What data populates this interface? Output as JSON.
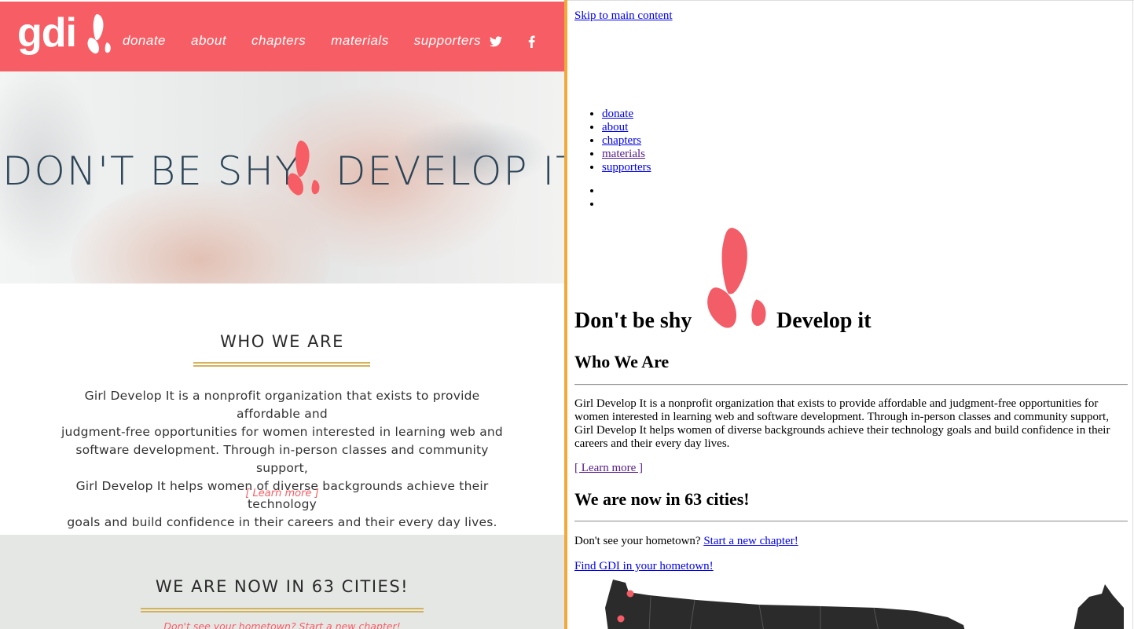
{
  "left": {
    "logo": "gdi",
    "nav": [
      "donate",
      "about",
      "chapters",
      "materials",
      "supporters"
    ],
    "social": {
      "twitter": "twitter-icon",
      "facebook": "facebook-icon"
    },
    "hero": {
      "title_part1": "DON'T BE SHY",
      "title_part2": "DEVELOP IT"
    },
    "who": {
      "title": "WHO WE ARE",
      "lines": [
        "Girl Develop It is a nonprofit organization that exists to provide affordable and",
        "judgment-free opportunities for women interested in learning web and",
        "software development. Through in-person classes and community support,",
        "Girl Develop It helps women of diverse backgrounds achieve their technology",
        "goals and build confidence in their careers and their every day lives."
      ],
      "learn_more": "[ Learn more ]"
    },
    "cities": {
      "title": "WE ARE NOW IN 63 CITIES!",
      "subtitle": "Don't see your hometown? Start a new chapter!"
    }
  },
  "right": {
    "skip": "Skip to main content",
    "nav": [
      "donate",
      "about",
      "chapters",
      "materials",
      "supporters"
    ],
    "hero": {
      "part1": "Don't be shy",
      "part2": "Develop it"
    },
    "who_title": "Who We Are",
    "who_body": "Girl Develop It is a nonprofit organization that exists to provide affordable and judgment-free opportunities for women interested in learning web and software development. Through in-person classes and community support, Girl Develop It helps women of diverse backgrounds achieve their technology goals and build confidence in their careers and their every day lives.",
    "learn_more": "[ Learn more ]",
    "cities_title": "We are now in 63 cities!",
    "hometown_text": "Don't see your hometown? ",
    "hometown_link": "Start a new chapter!",
    "find": "Find GDI in your hometown!"
  },
  "colors": {
    "brand": "#f75d64",
    "divider": "#f0a93a",
    "gold": "#d4b15b",
    "heading": "#2c4456"
  }
}
